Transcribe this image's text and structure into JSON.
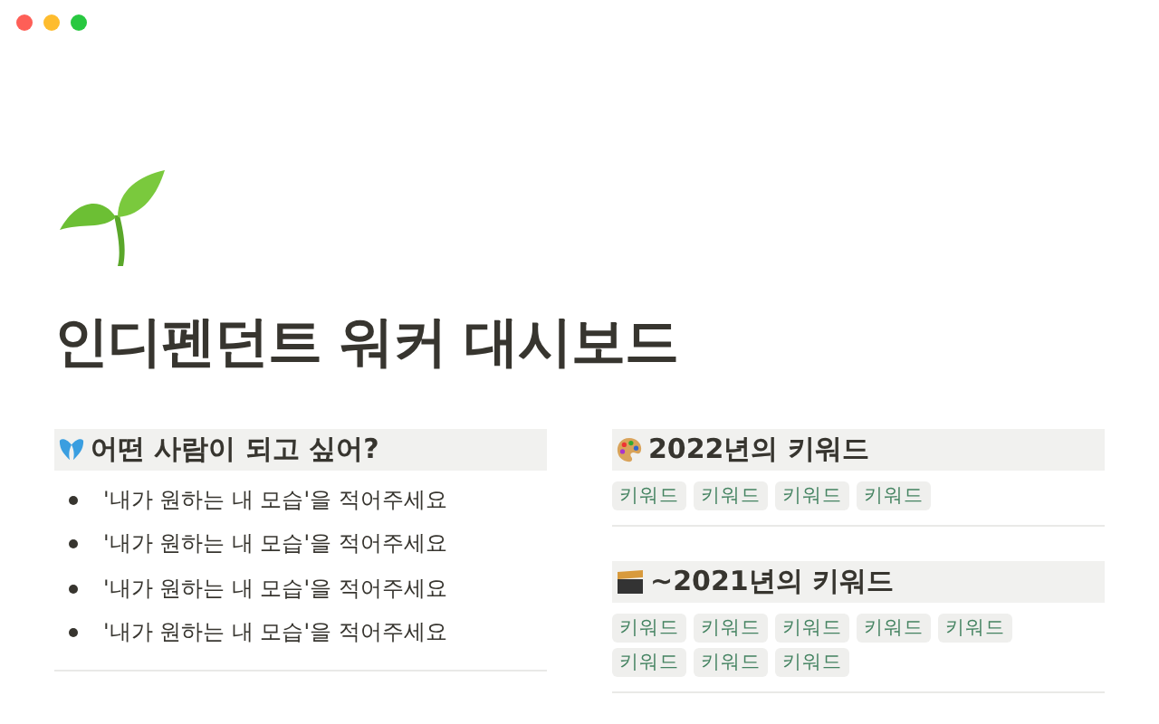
{
  "page": {
    "title": "인디펜던트 워커 대시보드"
  },
  "goal_section": {
    "heading": "어떤 사람이 되고 싶어?",
    "bullets": [
      "'내가 원하는 내 모습'을 적어주세요",
      "'내가 원하는 내 모습'을 적어주세요",
      "'내가 원하는 내 모습'을 적어주세요",
      "'내가 원하는 내 모습'을 적어주세요"
    ]
  },
  "keyword_sections": [
    {
      "kind": "palette",
      "heading": "2022년의 키워드",
      "tags": [
        "키워드",
        "키워드",
        "키워드",
        "키워드"
      ]
    },
    {
      "kind": "clapper",
      "heading": "~2021년의 키워드",
      "tags": [
        "키워드",
        "키워드",
        "키워드",
        "키워드",
        "키워드",
        "키워드",
        "키워드",
        "키워드"
      ]
    }
  ]
}
